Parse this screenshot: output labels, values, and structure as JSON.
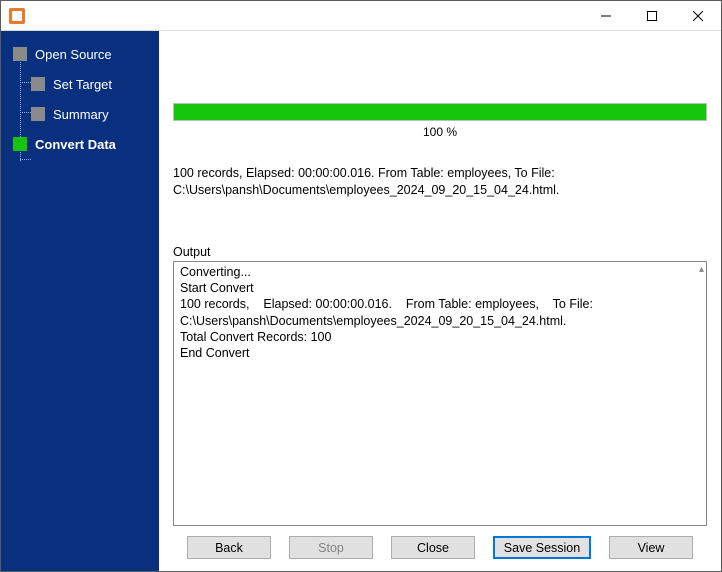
{
  "sidebar": {
    "items": [
      {
        "label": "Open Source",
        "level": 0,
        "active": false,
        "current": false
      },
      {
        "label": "Set Target",
        "level": 1,
        "active": false,
        "current": false
      },
      {
        "label": "Summary",
        "level": 1,
        "active": false,
        "current": false
      },
      {
        "label": "Convert Data",
        "level": 0,
        "active": true,
        "current": true
      }
    ]
  },
  "progress": {
    "percent_label": "100 %",
    "fill_percent": 100
  },
  "summary": "100 records,    Elapsed: 00:00:00.016.    From Table: employees,    To File: C:\\Users\\pansh\\Documents\\employees_2024_09_20_15_04_24.html.",
  "output": {
    "label": "Output",
    "lines": [
      "Converting...",
      "Start Convert",
      "100 records,    Elapsed: 00:00:00.016.    From Table: employees,    To File: C:\\Users\\pansh\\Documents\\employees_2024_09_20_15_04_24.html.",
      "Total Convert Records: 100",
      "End Convert"
    ]
  },
  "buttons": {
    "back": "Back",
    "stop": "Stop",
    "close": "Close",
    "save_session": "Save Session",
    "view": "View"
  }
}
